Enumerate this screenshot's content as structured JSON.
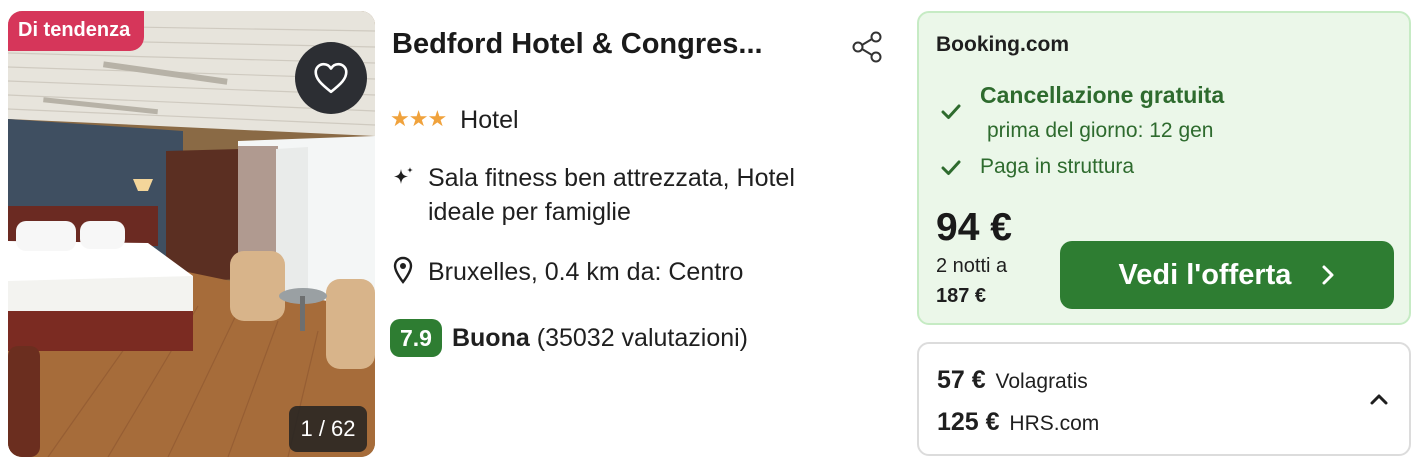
{
  "photo": {
    "badge": "Di tendenza",
    "counter": "1 / 62",
    "favorite_icon": "heart-outline-icon"
  },
  "hotel": {
    "name": "Bedford Hotel & Congres...",
    "stars": "★★★",
    "star_count": 3,
    "type": "Hotel",
    "features": "Sala fitness ben attrezzata, Hotel ideale per famiglie",
    "location": "Bruxelles, 0.4 km da: Centro",
    "rating": {
      "score": "7.9",
      "label": "Buona",
      "reviews": "(35032 valutazioni)"
    }
  },
  "deal": {
    "provider": "Booking.com",
    "cancellation": "Cancellazione gratuita",
    "cancellation_detail": "prima del giorno: 12 gen",
    "payment": "Paga in struttura",
    "price": "94 €",
    "nights": "2 notti a",
    "total": "187 €",
    "cta": "Vedi l'offerta"
  },
  "other_offers": [
    {
      "price": "57 €",
      "provider": "Volagratis"
    },
    {
      "price": "125 €",
      "provider": "HRS.com"
    }
  ],
  "colors": {
    "trend_badge": "#d6365a",
    "accent_green": "#2e7d32",
    "deal_bg": "#ebf7e9",
    "star": "#f0a23c"
  }
}
